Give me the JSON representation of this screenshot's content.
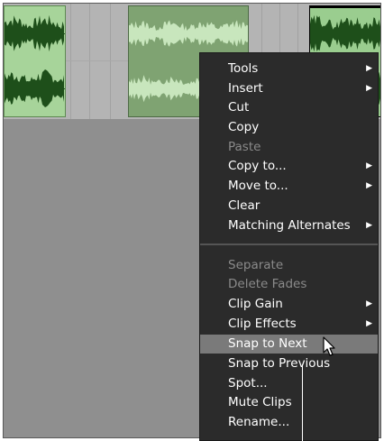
{
  "context_menu": {
    "items": [
      {
        "label": "Tools",
        "submenu": true,
        "enabled": true
      },
      {
        "label": "Insert",
        "submenu": true,
        "enabled": true
      },
      {
        "label": "Cut",
        "submenu": false,
        "enabled": true
      },
      {
        "label": "Copy",
        "submenu": false,
        "enabled": true
      },
      {
        "label": "Paste",
        "submenu": false,
        "enabled": false
      },
      {
        "label": "Copy to...",
        "submenu": true,
        "enabled": true
      },
      {
        "label": "Move to...",
        "submenu": true,
        "enabled": true
      },
      {
        "label": "Clear",
        "submenu": false,
        "enabled": true
      },
      {
        "label": "Matching Alternates",
        "submenu": true,
        "enabled": true
      },
      {
        "label": "Separate",
        "submenu": false,
        "enabled": false
      },
      {
        "label": "Delete Fades",
        "submenu": false,
        "enabled": false
      },
      {
        "label": "Clip Gain",
        "submenu": true,
        "enabled": true
      },
      {
        "label": "Clip Effects",
        "submenu": true,
        "enabled": true
      },
      {
        "label": "Snap to Next",
        "submenu": false,
        "enabled": true,
        "highlighted": true
      },
      {
        "label": "Snap to Previous",
        "submenu": false,
        "enabled": true
      },
      {
        "label": "Spot...",
        "submenu": false,
        "enabled": true
      },
      {
        "label": "Mute Clips",
        "submenu": false,
        "enabled": true
      },
      {
        "label": "Rename...",
        "submenu": false,
        "enabled": true
      }
    ]
  },
  "icons": {
    "submenu_arrow": "submenu-arrow-icon",
    "pointer": "mouse-pointer-icon"
  },
  "colors": {
    "menu_background": "#2b2b2b",
    "menu_highlight": "#7a7a7a",
    "clip_light": "#a7d49a",
    "clip_selected": "#7fa372",
    "waveform": "#1e4f1a"
  }
}
